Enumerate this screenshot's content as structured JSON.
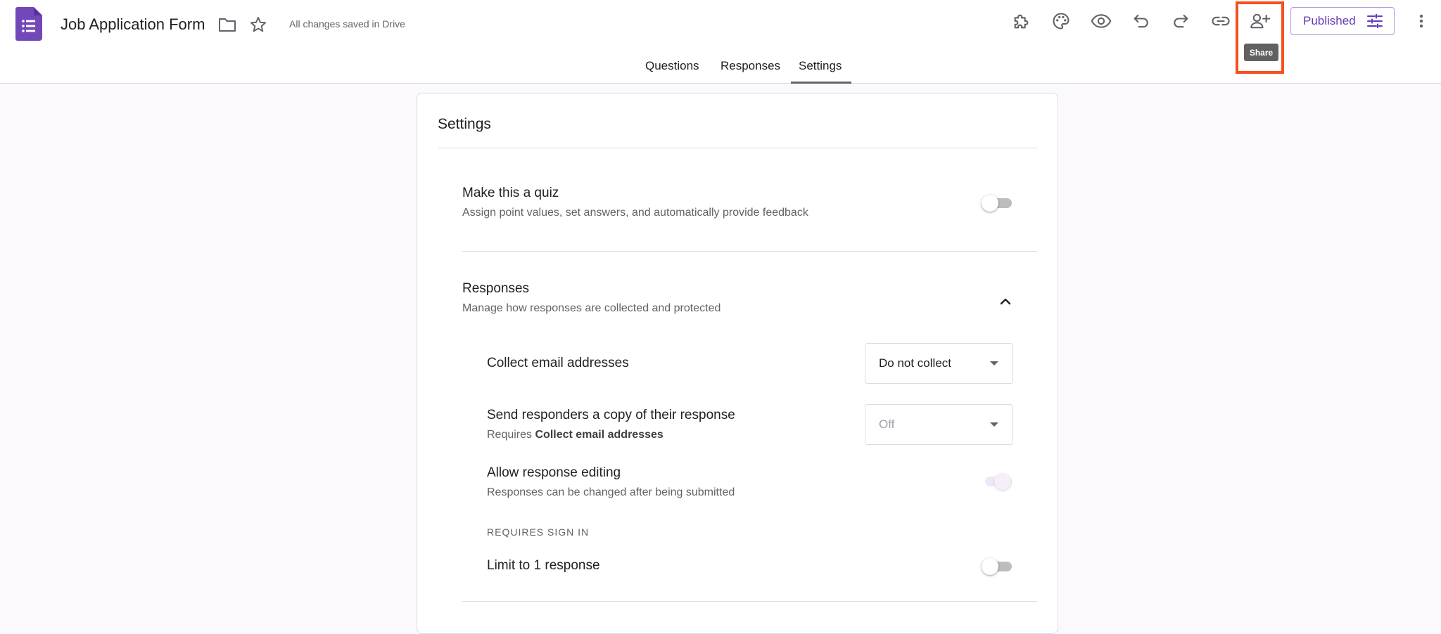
{
  "header": {
    "doc_title": "Job Application Form",
    "save_status": "All changes saved in Drive",
    "tooltip": "Share",
    "publish_label": "Published"
  },
  "tabs": [
    {
      "label": "Questions"
    },
    {
      "label": "Responses"
    },
    {
      "label": "Settings"
    }
  ],
  "settings": {
    "title": "Settings",
    "quiz": {
      "title": "Make this a quiz",
      "description": "Assign point values, set answers, and automatically provide feedback"
    },
    "responses": {
      "title": "Responses",
      "description": "Manage how responses are collected and protected",
      "collect_email": {
        "label": "Collect email addresses",
        "value": "Do not collect"
      },
      "send_copy": {
        "label": "Send responders a copy of their response",
        "requires_prefix": "Requires ",
        "requires_bold": "Collect email addresses",
        "value": "Off"
      },
      "allow_editing": {
        "label": "Allow response editing",
        "description": "Responses can be changed after being submitted"
      },
      "sign_in_label": "REQUIRES SIGN IN",
      "limit_one": {
        "label": "Limit to 1 response"
      }
    }
  },
  "colors": {
    "brand_purple": "#673ab7",
    "highlight": "#f4511e"
  }
}
